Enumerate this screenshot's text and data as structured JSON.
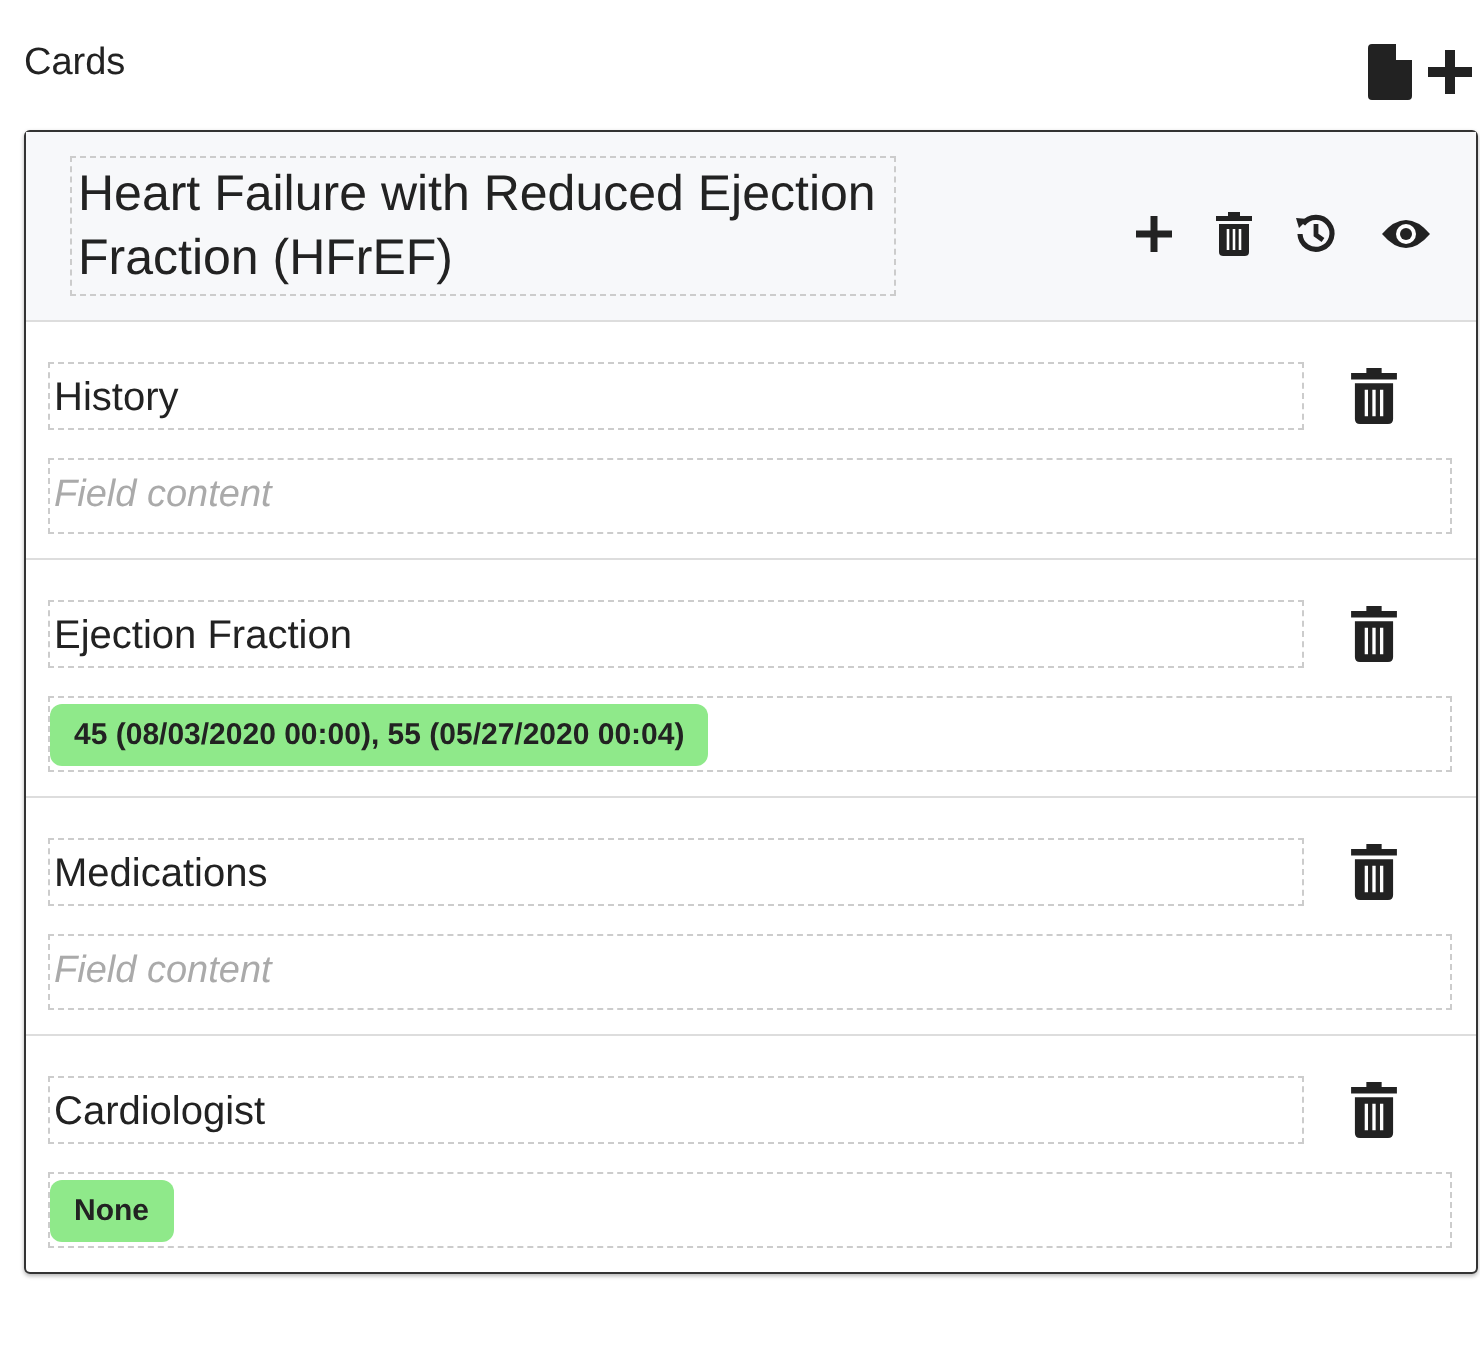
{
  "heading": "Cards",
  "card": {
    "title": "Heart Failure with Reduced Ejection Fraction (HFrEF)",
    "fields": [
      {
        "label": "History",
        "placeholder": "Field content"
      },
      {
        "label": "Ejection Fraction",
        "value": "45 (08/03/2020 00:00), 55 (05/27/2020 00:04)"
      },
      {
        "label": "Medications",
        "placeholder": "Field content"
      },
      {
        "label": "Cardiologist",
        "value": "None"
      }
    ]
  }
}
